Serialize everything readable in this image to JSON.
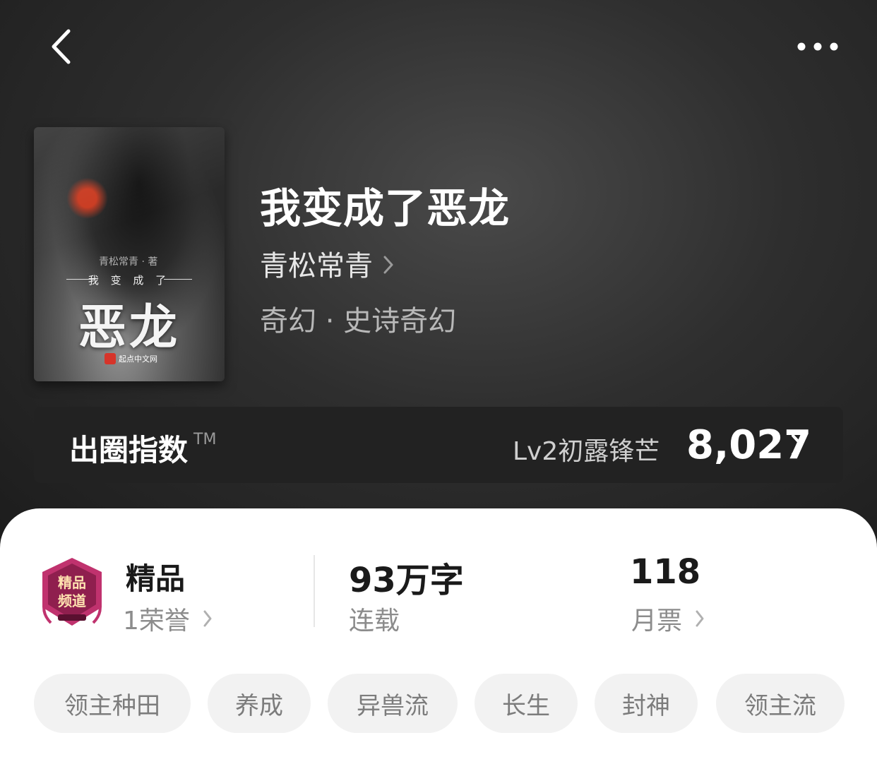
{
  "header": {
    "back_icon": "back-arrow-icon",
    "more_icon": "more-dots-icon"
  },
  "cover": {
    "author_mark": "青松常青 · 著",
    "subtitle": "我 变 成 了",
    "title": "恶龙",
    "publisher": "起点中文网"
  },
  "book": {
    "title": "我变成了恶龙",
    "author": "青松常青",
    "genre": "奇幻 · 史诗奇幻"
  },
  "index": {
    "label": "出圈指数",
    "tm": "TM",
    "level": "Lv2初露锋芒",
    "value": "8,027"
  },
  "stats": {
    "quality": {
      "title": "精品",
      "sub": "1荣誉",
      "badge_text_top": "精品",
      "badge_text_bottom": "频道"
    },
    "words": {
      "title": "93万字",
      "sub": "连载"
    },
    "tickets": {
      "title": "118",
      "sub": "月票"
    }
  },
  "tags": [
    "领主种田",
    "养成",
    "异兽流",
    "长生",
    "封神",
    "领主流"
  ],
  "colors": {
    "hero_bg": "#2e2e2e",
    "card_bg": "#ffffff",
    "tag_bg": "#f2f2f2",
    "badge_primary": "#c0326e"
  }
}
